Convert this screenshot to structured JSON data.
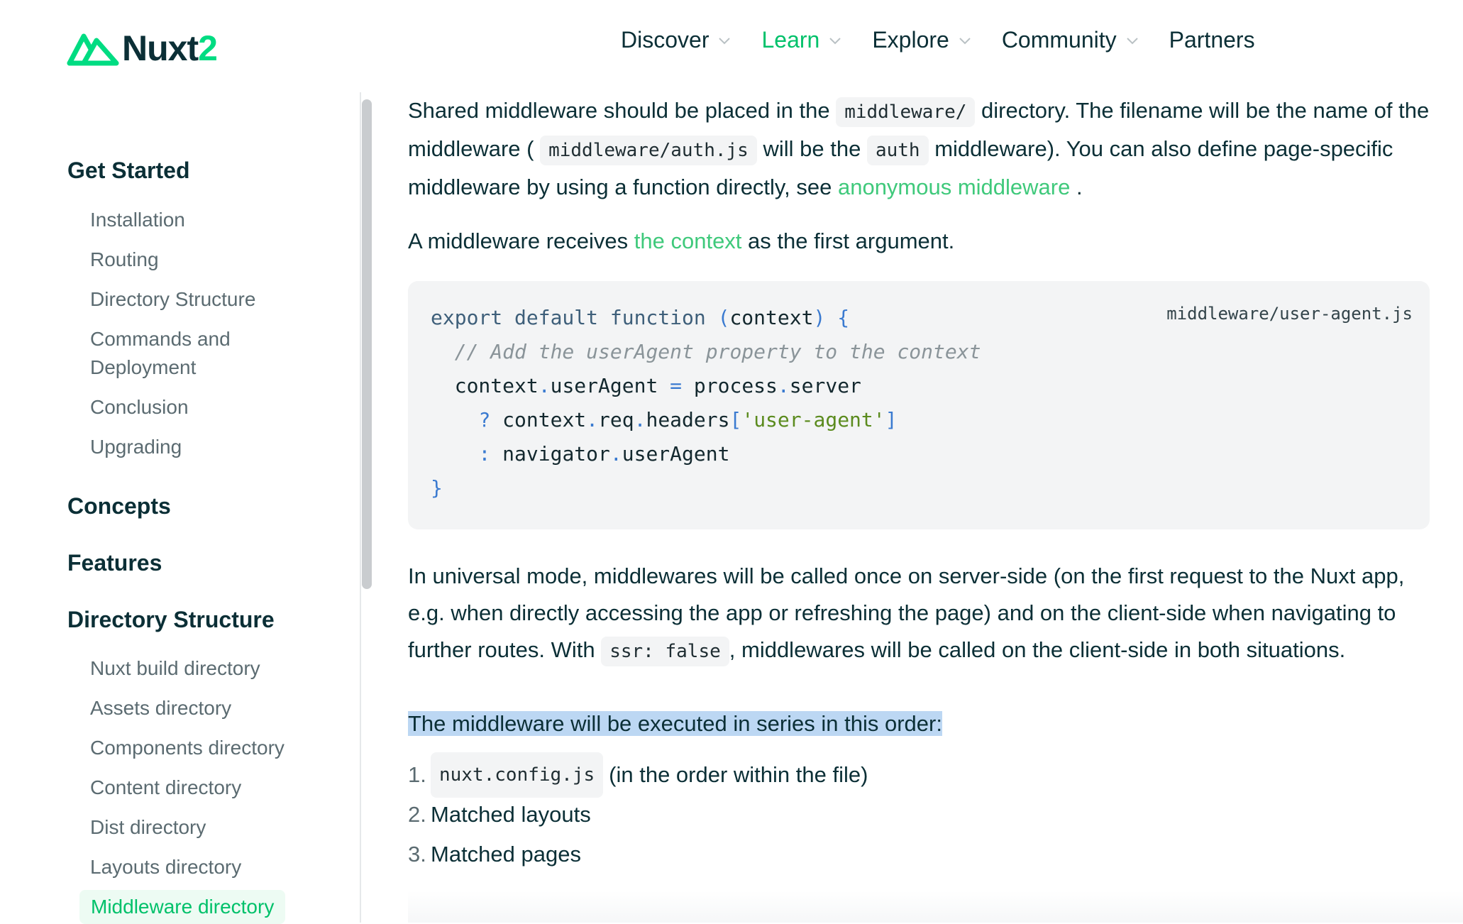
{
  "header": {
    "logo_text": "Nuxt",
    "logo_version": "2",
    "nav": [
      {
        "label": "Discover",
        "has_dropdown": true,
        "active": false
      },
      {
        "label": "Learn",
        "has_dropdown": true,
        "active": true
      },
      {
        "label": "Explore",
        "has_dropdown": true,
        "active": false
      },
      {
        "label": "Community",
        "has_dropdown": true,
        "active": false
      },
      {
        "label": "Partners",
        "has_dropdown": false,
        "active": false
      }
    ]
  },
  "sidebar": {
    "sections": [
      {
        "title": "Get Started",
        "items": [
          "Installation",
          "Routing",
          "Directory Structure",
          "Commands and Deployment",
          "Conclusion",
          "Upgrading"
        ]
      },
      {
        "title": "Concepts",
        "items": []
      },
      {
        "title": "Features",
        "items": []
      },
      {
        "title": "Directory Structure",
        "items": [
          "Nuxt build directory",
          "Assets directory",
          "Components directory",
          "Content directory",
          "Dist directory",
          "Layouts directory",
          "Middleware directory"
        ]
      }
    ],
    "active_item": "Middleware directory"
  },
  "content": {
    "p1": {
      "t1": "Shared middleware should be placed in the",
      "c1": "middleware/",
      "t2": "directory. The filename will be the name of the middleware (",
      "c2": "middleware/auth.js",
      "t3": "will be the",
      "c3": "auth",
      "t4": "middleware). You can also define page-specific middleware by using a function directly, see",
      "link": "anonymous middleware",
      "t5": "."
    },
    "p2": {
      "t1": "A middleware receives",
      "link": "the context",
      "t2": "as the first argument."
    },
    "code": {
      "filename": "middleware/user-agent.js",
      "line1_kw": "export default function",
      "line1_rest": "context",
      "comment": "// Add the userAgent property to the context",
      "line3_a": "context",
      "line3_b": "userAgent",
      "line3_c": "process",
      "line3_d": "server",
      "line4_a": "context",
      "line4_b": "req",
      "line4_c": "headers",
      "line4_str": "'user-agent'",
      "line5_a": "navigator",
      "line5_b": "userAgent"
    },
    "p3": {
      "t1": "In universal mode, middlewares will be called once on server-side (on the first request to the Nuxt app, e.g. when directly accessing the app or refreshing the page) and on the client-side when navigating to further routes. With",
      "c1": "ssr: false",
      "t2": ", middlewares will be called on the client-side in both situations."
    },
    "p4": "The middleware will be executed in series in this order:",
    "list": [
      {
        "num": "1.",
        "code": "nuxt.config.js",
        "text": "(in the order within the file)"
      },
      {
        "num": "2.",
        "code": "",
        "text": "Matched layouts"
      },
      {
        "num": "3.",
        "code": "",
        "text": "Matched pages"
      }
    ]
  }
}
